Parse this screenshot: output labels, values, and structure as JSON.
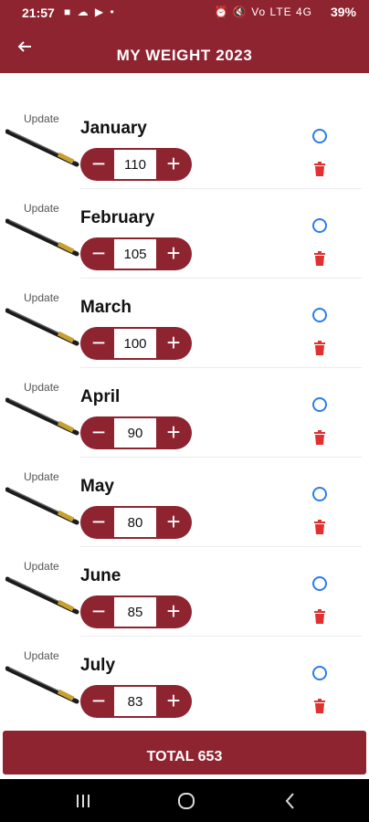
{
  "status_bar": {
    "time": "21:57",
    "left_icons": "■ ☁ ▶ •",
    "right_icons": "⏰ 🔇 Vo LTE 4G",
    "battery": "39%"
  },
  "header": {
    "title": "MY WEIGHT 2023",
    "back_icon": "arrow-left-icon"
  },
  "update_label": "Update",
  "months": [
    {
      "name": "January",
      "value": "110"
    },
    {
      "name": "February",
      "value": "105"
    },
    {
      "name": "March",
      "value": "100"
    },
    {
      "name": "April",
      "value": "90"
    },
    {
      "name": "May",
      "value": "80"
    },
    {
      "name": "June",
      "value": "85"
    },
    {
      "name": "July",
      "value": "83"
    }
  ],
  "stepper": {
    "minus": "−",
    "plus": "+"
  },
  "total_label": "TOTAL 653",
  "colors": {
    "primary": "#8f2431",
    "radio": "#2b7de9",
    "delete": "#e03131"
  }
}
